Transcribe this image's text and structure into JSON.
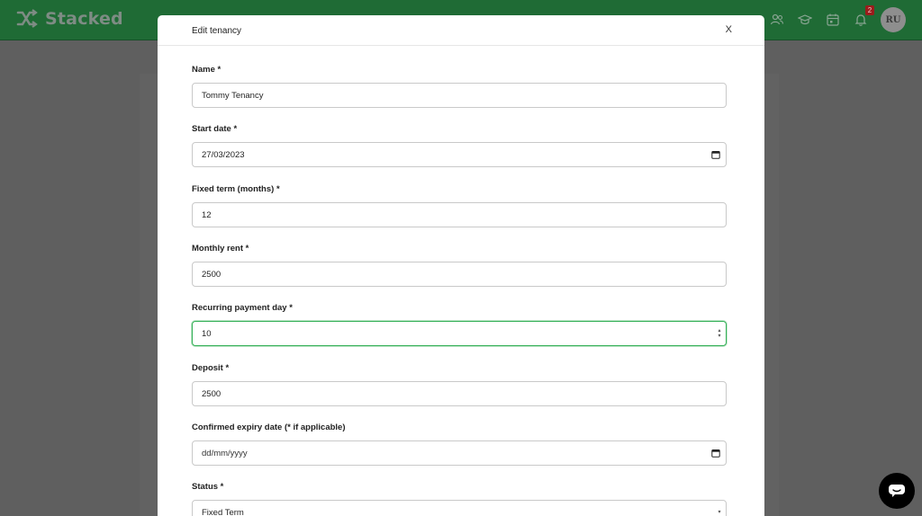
{
  "app": {
    "name": "Stacked",
    "avatar_initials": "RU",
    "notification_count": "2"
  },
  "nav_icons": [
    "people-icon",
    "graduation-cap-icon",
    "calendar-icon",
    "bell-icon"
  ],
  "modal": {
    "title": "Edit tenancy",
    "close_label": "X",
    "fields": {
      "name": {
        "label": "Name *",
        "value": "Tommy Tenancy"
      },
      "start_date": {
        "label": "Start date *",
        "value": "27/03/2023"
      },
      "fixed_term": {
        "label": "Fixed term (months) *",
        "value": "12"
      },
      "monthly_rent": {
        "label": "Monthly rent *",
        "value": "2500"
      },
      "payment_day": {
        "label": "Recurring payment day *",
        "value": "10"
      },
      "deposit": {
        "label": "Deposit *",
        "value": "2500"
      },
      "expiry_date": {
        "label": "Confirmed expiry date (* if applicable)",
        "value": "dd/mm/yyyy"
      },
      "status": {
        "label": "Status *",
        "value": "Fixed Term"
      }
    }
  },
  "colors": {
    "brand_green": "#1f6b35",
    "focus_green": "#35b058",
    "overlay": "#5f5f5f"
  }
}
